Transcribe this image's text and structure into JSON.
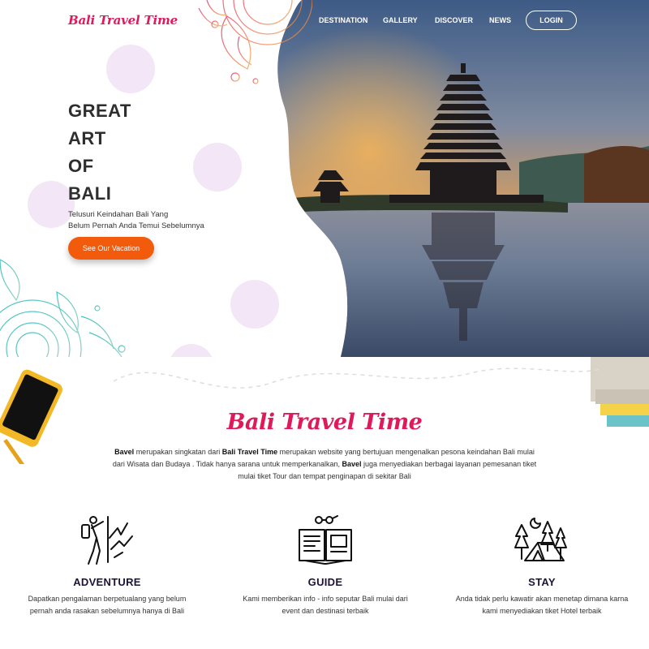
{
  "brand": {
    "name": "Bali Travel Time"
  },
  "nav": {
    "items": [
      "DESTINATION",
      "GALLERY",
      "DISCOVER",
      "NEWS"
    ],
    "login": "LOGIN"
  },
  "hero": {
    "title_lines": [
      "GREAT",
      "ART",
      "OF",
      "BALI"
    ],
    "subtitle_lines": [
      "Telusuri Keindahan Bali Yang",
      "Belum Pernah Anda Temui Sebelumnya"
    ],
    "cta": "See Our Vacation"
  },
  "about": {
    "title": "Bali Travel Time",
    "p1_bold": "Bavel",
    "p1_a": " merupakan singkatan dari ",
    "p1_bold2": "Bali Travel Time",
    "p1_b": " merupakan website yang bertujuan mengenalkan pesona keindahan Bali mulai dari Wisata dan Budaya . Tidak hanya sarana untuk memperkanalkan, ",
    "p1_bold3": "Bavel",
    "p1_c": " juga menyediakan berbagai layanan pemesanan tiket mulai tiket Tour dan tempat penginapan di sekitar Bali"
  },
  "features": [
    {
      "icon": "hiker-icon",
      "title": "ADVENTURE",
      "desc": "Dapatkan pengalaman berpetualang yang belum pernah anda rasakan sebelumnya hanya di Bali"
    },
    {
      "icon": "guide-book-icon",
      "title": "GUIDE",
      "desc": "Kami memberikan info - info seputar Bali mulai dari event dan destinasi terbaik"
    },
    {
      "icon": "camping-tent-icon",
      "title": "STAY",
      "desc": "Anda tidak perlu kawatir akan menetap dimana karna kami menyediakan tiket Hotel terbaik"
    }
  ],
  "colors": {
    "brand": "#e0195a",
    "cta": "#f25a0c",
    "heading": "#1d1238"
  }
}
